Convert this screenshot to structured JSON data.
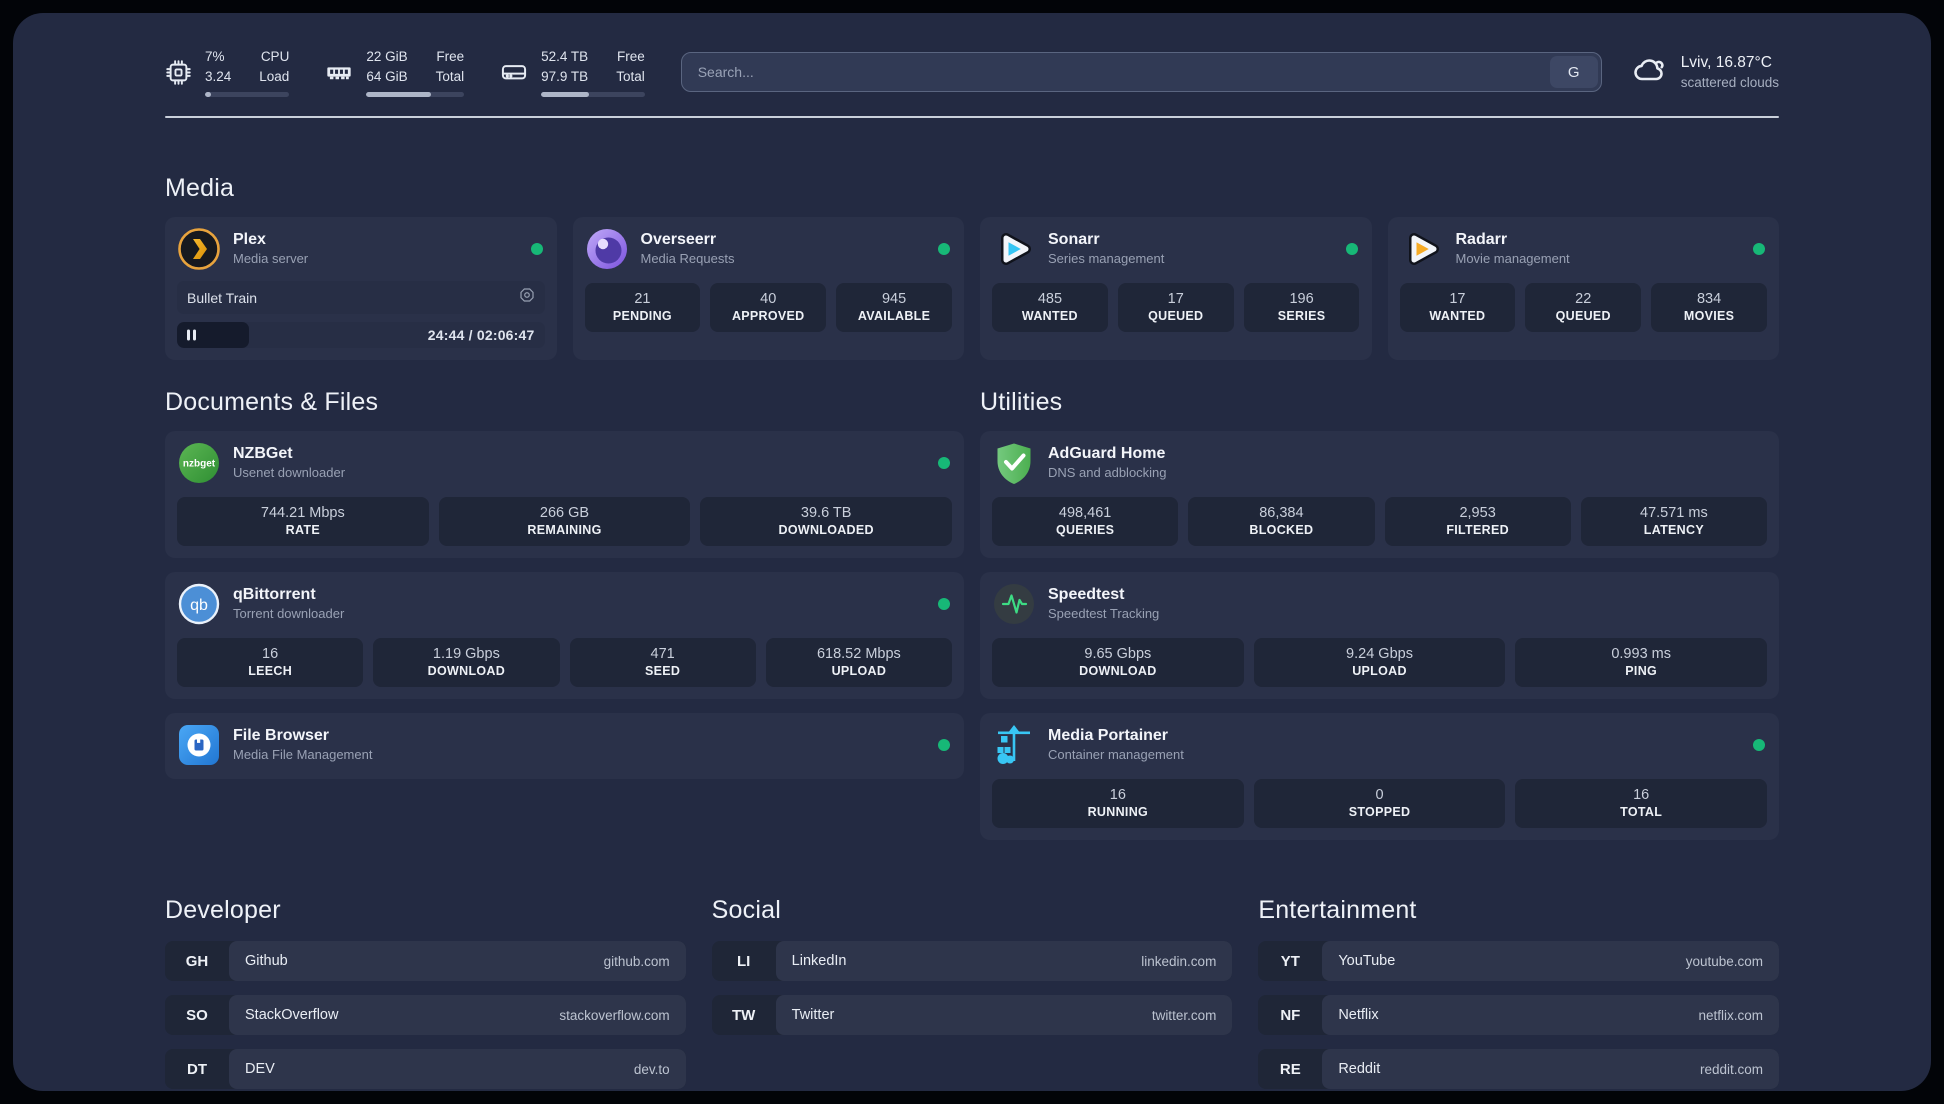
{
  "topbar": {
    "metrics": [
      {
        "icon": "cpu-icon",
        "values": [
          "7%",
          "3.24"
        ],
        "labels": [
          "CPU",
          "Load"
        ],
        "progress_percent": 7
      },
      {
        "icon": "memory-icon",
        "values": [
          "22 GiB",
          "64 GiB"
        ],
        "labels": [
          "Free",
          "Total"
        ],
        "progress_percent": 66
      },
      {
        "icon": "disk-icon",
        "values": [
          "52.4 TB",
          "97.9 TB"
        ],
        "labels": [
          "Free",
          "Total"
        ],
        "progress_percent": 46
      }
    ],
    "search": {
      "placeholder": "Search...",
      "button_label": "G"
    },
    "weather": {
      "location_temp": "Lviv, 16.87°C",
      "condition": "scattered clouds"
    }
  },
  "sections": {
    "media": {
      "title": "Media",
      "plex": {
        "title": "Plex",
        "subtitle": "Media server",
        "online": true,
        "now_playing": {
          "title": "Bullet Train",
          "time_display": "24:44 / 02:06:47",
          "progress_percent": 19.5,
          "state": "paused"
        }
      },
      "overseerr": {
        "title": "Overseerr",
        "subtitle": "Media Requests",
        "online": true,
        "stats": [
          {
            "value": "21",
            "label": "PENDING"
          },
          {
            "value": "40",
            "label": "APPROVED"
          },
          {
            "value": "945",
            "label": "AVAILABLE"
          }
        ]
      },
      "sonarr": {
        "title": "Sonarr",
        "subtitle": "Series management",
        "online": true,
        "stats": [
          {
            "value": "485",
            "label": "WANTED"
          },
          {
            "value": "17",
            "label": "QUEUED"
          },
          {
            "value": "196",
            "label": "SERIES"
          }
        ]
      },
      "radarr": {
        "title": "Radarr",
        "subtitle": "Movie management",
        "online": true,
        "stats": [
          {
            "value": "17",
            "label": "WANTED"
          },
          {
            "value": "22",
            "label": "QUEUED"
          },
          {
            "value": "834",
            "label": "MOVIES"
          }
        ]
      }
    },
    "documents": {
      "title": "Documents & Files",
      "nzbget": {
        "title": "NZBGet",
        "subtitle": "Usenet downloader",
        "online": true,
        "icon_text": "nzbget",
        "stats": [
          {
            "value": "744.21 Mbps",
            "label": "RATE"
          },
          {
            "value": "266 GB",
            "label": "REMAINING"
          },
          {
            "value": "39.6 TB",
            "label": "DOWNLOADED"
          }
        ]
      },
      "qbittorrent": {
        "title": "qBittorrent",
        "subtitle": "Torrent downloader",
        "online": true,
        "icon_text": "qb",
        "stats": [
          {
            "value": "16",
            "label": "LEECH"
          },
          {
            "value": "1.19 Gbps",
            "label": "DOWNLOAD"
          },
          {
            "value": "471",
            "label": "SEED"
          },
          {
            "value": "618.52 Mbps",
            "label": "UPLOAD"
          }
        ]
      },
      "filebrowser": {
        "title": "File Browser",
        "subtitle": "Media File Management",
        "online": true
      }
    },
    "utilities": {
      "title": "Utilities",
      "adguard": {
        "title": "AdGuard Home",
        "subtitle": "DNS and adblocking",
        "stats": [
          {
            "value": "498,461",
            "label": "QUERIES"
          },
          {
            "value": "86,384",
            "label": "BLOCKED"
          },
          {
            "value": "2,953",
            "label": "FILTERED"
          },
          {
            "value": "47.571 ms",
            "label": "LATENCY"
          }
        ]
      },
      "speedtest": {
        "title": "Speedtest",
        "subtitle": "Speedtest Tracking",
        "stats": [
          {
            "value": "9.65 Gbps",
            "label": "DOWNLOAD"
          },
          {
            "value": "9.24 Gbps",
            "label": "UPLOAD"
          },
          {
            "value": "0.993 ms",
            "label": "PING"
          }
        ]
      },
      "portainer": {
        "title": "Media Portainer",
        "subtitle": "Container management",
        "online": true,
        "stats": [
          {
            "value": "16",
            "label": "RUNNING"
          },
          {
            "value": "0",
            "label": "STOPPED"
          },
          {
            "value": "16",
            "label": "TOTAL"
          }
        ]
      }
    },
    "bookmarks": {
      "developer": {
        "title": "Developer",
        "items": [
          {
            "abbr": "GH",
            "name": "Github",
            "url": "github.com"
          },
          {
            "abbr": "SO",
            "name": "StackOverflow",
            "url": "stackoverflow.com"
          },
          {
            "abbr": "DT",
            "name": "DEV",
            "url": "dev.to"
          }
        ]
      },
      "social": {
        "title": "Social",
        "items": [
          {
            "abbr": "LI",
            "name": "LinkedIn",
            "url": "linkedin.com"
          },
          {
            "abbr": "TW",
            "name": "Twitter",
            "url": "twitter.com"
          }
        ]
      },
      "entertainment": {
        "title": "Entertainment",
        "items": [
          {
            "abbr": "YT",
            "name": "YouTube",
            "url": "youtube.com"
          },
          {
            "abbr": "NF",
            "name": "Netflix",
            "url": "netflix.com"
          },
          {
            "abbr": "RE",
            "name": "Reddit",
            "url": "reddit.com"
          }
        ]
      }
    }
  },
  "icons": {
    "cpu-icon": "chip outline",
    "memory-icon": "ram stick",
    "disk-icon": "hard drive",
    "weather-icon": "cloud outline",
    "plex-icon": "gold chevron in dark circle",
    "overseerr-icon": "purple eye sphere",
    "sonarr-icon": "cyan play triangle",
    "radarr-icon": "amber play triangle",
    "nzbget-icon": "green circle wordmark",
    "qbittorrent-icon": "blue circle qb",
    "filebrowser-icon": "blue square floppy",
    "adguard-icon": "green shield check",
    "speedtest-icon": "green pulse in dark circle",
    "portainer-icon": "light-blue crane",
    "session-settings-icon": "octagon aperture",
    "pause-icon": "pause bars",
    "status-dot": "green circle"
  },
  "colors": {
    "page_bg": "#232a42",
    "card_bg": "#2a3149",
    "stat_bg": "#1f2638",
    "status_green": "#17b877",
    "divider": "#c9cfda",
    "accent_plex": "#e8a33d"
  }
}
